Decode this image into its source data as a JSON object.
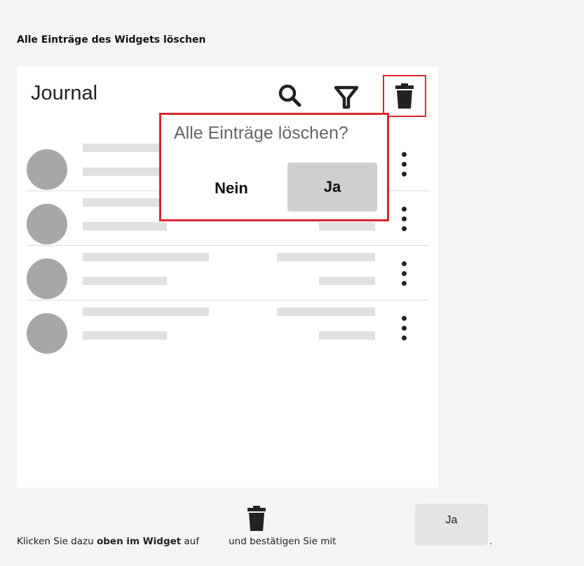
{
  "heading": "Alle Einträge des Widgets löschen",
  "widget": {
    "title": "Journal",
    "toolbar": {
      "search_icon": "search-icon",
      "filter_icon": "filter-icon",
      "trash_icon": "trash-icon"
    },
    "rows": [
      {
        "id": 1
      },
      {
        "id": 2
      },
      {
        "id": 3
      },
      {
        "id": 4
      }
    ]
  },
  "dialog": {
    "title": "Alle Einträge löschen?",
    "no_label": "Nein",
    "yes_label": "Ja"
  },
  "instruction": {
    "before": "Klicken Sie dazu ",
    "bold": "oben im Widget",
    "after_bold": " auf",
    "middle": "und bestätigen Sie mit",
    "inline_button": "Ja",
    "end": "."
  },
  "colors": {
    "highlight": "#d8282e",
    "avatar": "#a7a7a7",
    "placeholder": "#e1e1e1"
  }
}
